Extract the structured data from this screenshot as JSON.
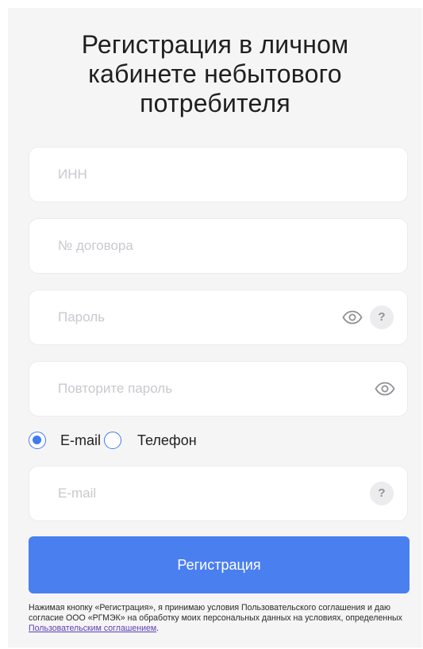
{
  "form": {
    "title_lines": [
      "Регистрация в личном",
      "кабинете небытового",
      "потребителя"
    ],
    "inn_placeholder": "ИНН",
    "contract_placeholder": "№ договора",
    "password_placeholder": "Пароль",
    "password_repeat_placeholder": "Повторите пароль",
    "email_placeholder": "E-mail",
    "help_glyph": "?",
    "contact_options": [
      {
        "label": "E-mail",
        "selected": true
      },
      {
        "label": "Телефон",
        "selected": false
      }
    ],
    "submit_label": "Регистрация",
    "legal_text": "Нажимая кнопку «Регистрация», я принимаю условия Пользовательского соглашения и даю согласие ООО «РГМЭК» на обработку моих персональных данных на условиях, определенных ",
    "legal_link": "Пользовательским соглашением",
    "legal_end": "."
  },
  "icons": {
    "eye": "eye-icon",
    "help": "help-icon"
  },
  "colors": {
    "accent": "#4a7ff0",
    "radio": "#3f7bee",
    "background": "#f5f5f6",
    "placeholder": "#c8c9ce",
    "link": "#5b3fb3"
  }
}
